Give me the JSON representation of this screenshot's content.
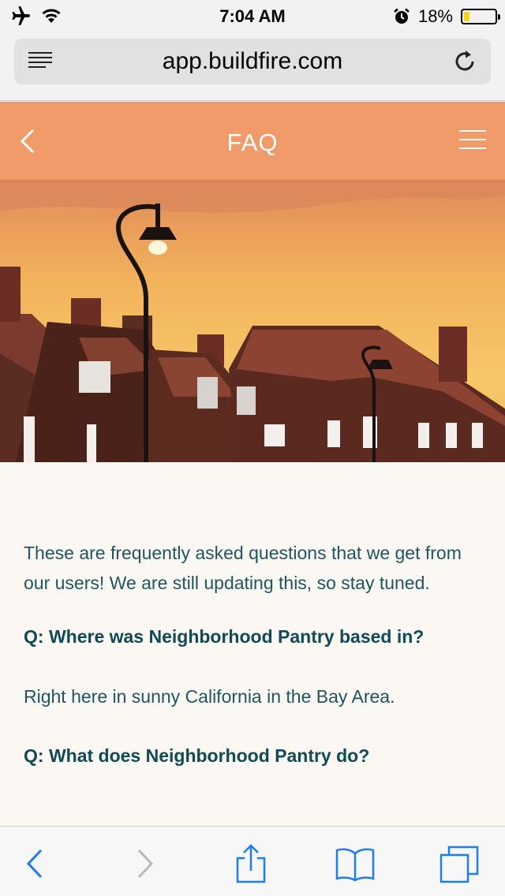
{
  "status_bar": {
    "time": "7:04 AM",
    "battery_percent": "18%",
    "battery_level": 0.18,
    "icons": [
      "airplane-mode-icon",
      "wifi-icon",
      "alarm-icon",
      "battery-icon"
    ]
  },
  "browser": {
    "url": "app.buildfire.com",
    "icons": [
      "reader-view-icon",
      "reload-icon"
    ]
  },
  "app_header": {
    "title": "FAQ",
    "background_color": "#f19a6a",
    "icons": [
      "back-chevron-icon",
      "hamburger-menu-icon"
    ]
  },
  "content": {
    "intro": "These are frequently asked questions that we get from our users! We are still updating this, so stay tuned.",
    "faqs": [
      {
        "question": "Q: Where was Neighborhood Pantry based in?",
        "answer": "Right here in sunny California in the Bay Area."
      },
      {
        "question": "Q: What does Neighborhood Pantry do?"
      }
    ],
    "text_color": "#1f5560"
  },
  "toolbar": {
    "icons": [
      "back-icon",
      "forward-icon",
      "share-icon",
      "bookmarks-icon",
      "tabs-icon"
    ],
    "accent_color": "#1a7df2"
  }
}
